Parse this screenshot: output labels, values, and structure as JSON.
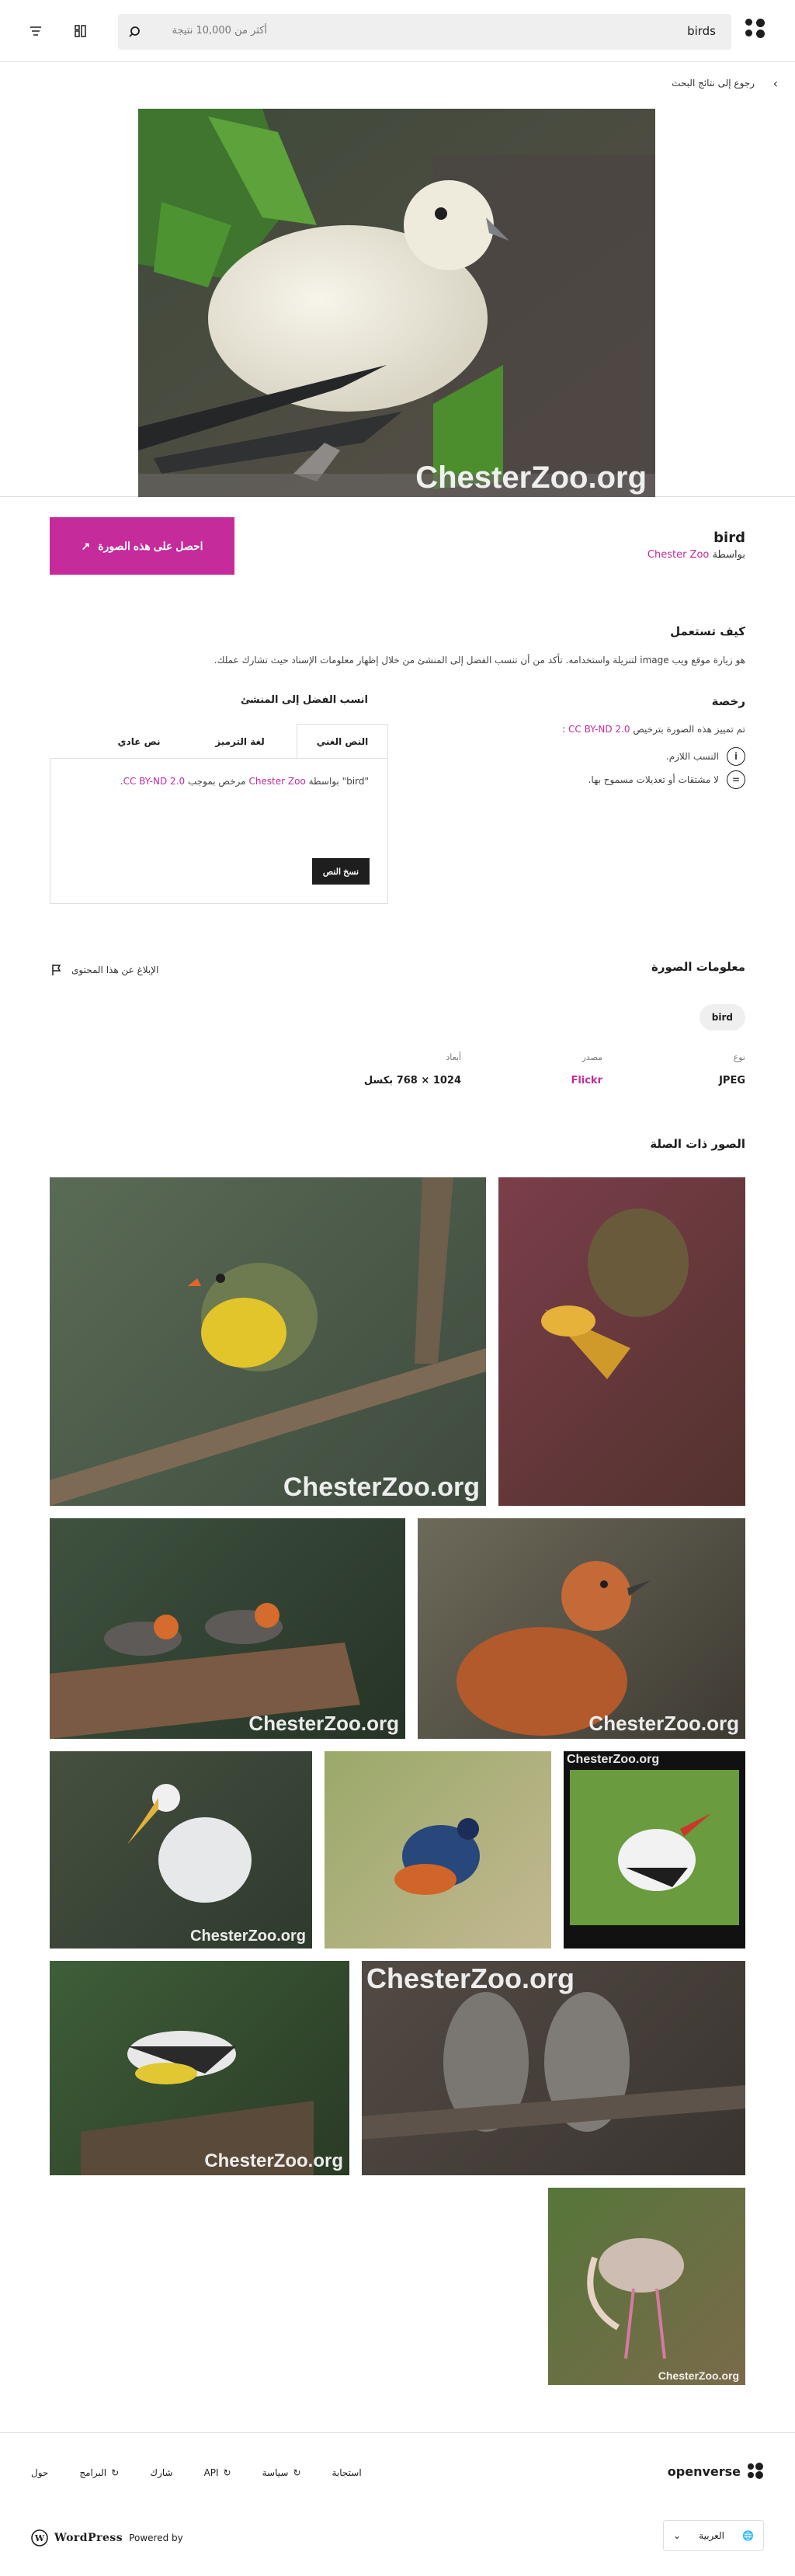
{
  "header": {
    "brand": "openverse",
    "search_query": "birds",
    "result_count": "أكثر من 10,000 نتيجة"
  },
  "back_link": "رجوع إلى نتائج البحث",
  "image": {
    "watermark": "ChesterZoo.org",
    "title": "bird",
    "by_prefix": "بواسطة",
    "creator": "Chester Zoo"
  },
  "cta_label": "احصل على هذه الصورة",
  "how_to_use": {
    "heading": "كيف تستعمل",
    "text": "هو زيارة موقع ويب image لتنزيلة واستخدامه. تأكد من أن تنسب الفضل إلى المنشئ من خلال إظهار معلومات الإسناد حيث تشارك عملك."
  },
  "license": {
    "heading": "رخصة",
    "text": "تم تمييز هذه الصورة بترخيص",
    "license_name": "CC BY-ND 2.0",
    "items": [
      "النسب اللازم.",
      "لا مشتقات أو تعديلات مسموح بها."
    ],
    "icons": [
      "attribution-icon",
      "no-derivatives-icon"
    ]
  },
  "attribution": {
    "heading": "انسب الفضل إلى المنشئ",
    "tabs": [
      "النص الغني",
      "لغة الترميز",
      "نص عادي"
    ],
    "text_prefix": "\"",
    "text_title": "bird",
    "text_by": "\" بواسطة",
    "text_creator": "Chester Zoo",
    "text_license_prefix": "مرخص بموجب",
    "text_license": "CC BY-ND 2.0",
    "copy_button": "نسخ النص"
  },
  "image_info": {
    "heading": "معلومات الصورة",
    "report": "الإبلاغ عن هذا المحتوى",
    "tag": "bird",
    "fields": [
      {
        "label": "نوع",
        "value": "JPEG"
      },
      {
        "label": "مصدر",
        "value": "Flickr"
      },
      {
        "label": "أبعاد",
        "value": "1024 × 768 بكسل"
      }
    ]
  },
  "related": {
    "heading": "الصور ذات الصلة",
    "watermark": "ChesterZoo.org"
  },
  "footer": {
    "brand": "openverse",
    "nav": [
      "حول",
      "البرامج",
      "شارك",
      "API",
      "سياسة",
      "استجابة"
    ],
    "language": "العربية",
    "powered_by": "Powered by",
    "wordpress": "WordPress"
  },
  "colors": {
    "accent": "#c52b9b",
    "dark": "#1e1e1e",
    "light_gray": "#efefef"
  }
}
